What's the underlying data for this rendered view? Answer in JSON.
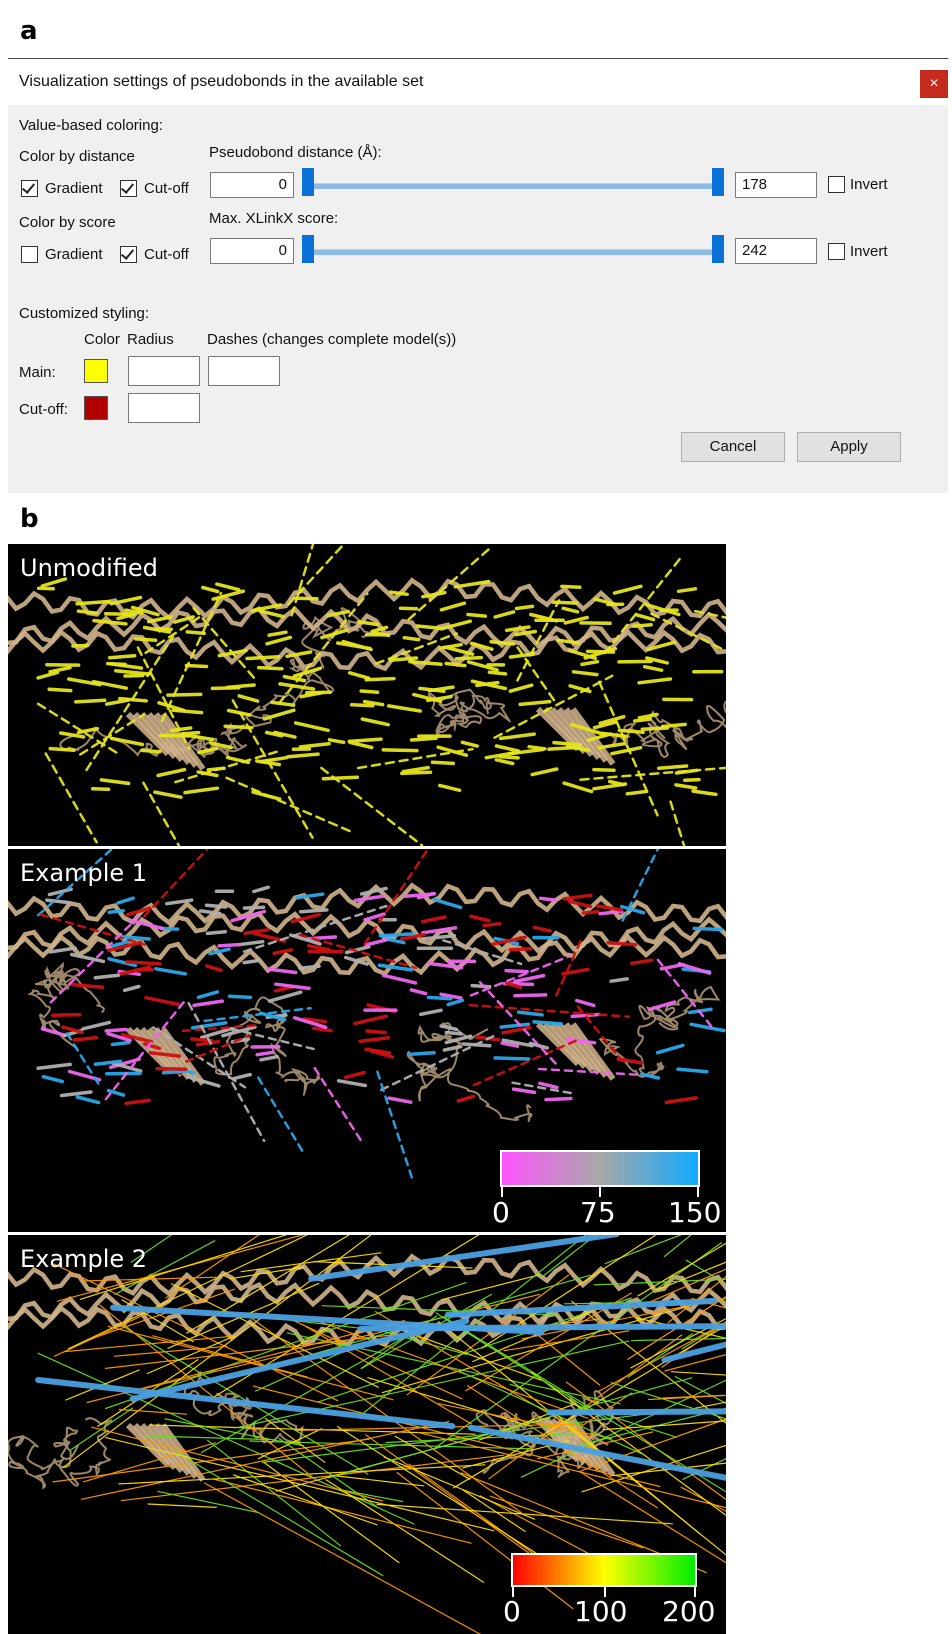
{
  "panel_a_letter": "a",
  "panel_b_letter": "b",
  "dialog": {
    "title": "Visualization settings of pseudobonds in the available set",
    "close_glyph": "×",
    "value_based_coloring_label": "Value-based coloring:",
    "distance": {
      "group_label": "Color by distance",
      "slider_label": "Pseudobond distance (Å):",
      "gradient_label": "Gradient",
      "gradient_checked": true,
      "cutoff_label": "Cut-off",
      "cutoff_checked": true,
      "min_value": "0",
      "max_value": "178",
      "slider_low_fraction": 0,
      "slider_high_fraction": 1,
      "invert_label": "Invert",
      "invert_checked": false
    },
    "score": {
      "group_label": "Color by score",
      "slider_label": "Max. XLinkX score:",
      "gradient_label": "Gradient",
      "gradient_checked": false,
      "cutoff_label": "Cut-off",
      "cutoff_checked": true,
      "min_value": "0",
      "max_value": "242",
      "slider_low_fraction": 0,
      "slider_high_fraction": 1,
      "invert_label": "Invert",
      "invert_checked": false
    },
    "custom": {
      "heading": "Customized styling:",
      "col_color": "Color",
      "col_radius": "Radius",
      "col_dashes": "Dashes (changes complete model(s))",
      "main_label": "Main:",
      "main_color": "#ffff00",
      "main_radius": "",
      "main_dashes": "",
      "cutoff_label": "Cut-off:",
      "cutoff_color": "#b00000",
      "cutoff_radius": ""
    },
    "cancel_label": "Cancel",
    "apply_label": "Apply"
  },
  "views": {
    "unmodified": {
      "label": "Unmodified",
      "bond_color": "#e5e51a"
    },
    "example1": {
      "label": "Example 1",
      "colors": [
        "#ee66ee",
        "#b0b0b0",
        "#29a8e8",
        "#cc1111"
      ],
      "colorbar": {
        "ticks": [
          "0",
          "75",
          "150"
        ],
        "gradient": [
          "#ff55ff",
          "#a8a8a8",
          "#11aaff"
        ]
      }
    },
    "example2": {
      "label": "Example 2",
      "colors": [
        "#ff9900",
        "#ffdd00",
        "#66dd22",
        "#4a9fe0"
      ],
      "colorbar": {
        "ticks": [
          "0",
          "100",
          "200"
        ],
        "gradient": [
          "#ff0000",
          "#ffff00",
          "#00ee00"
        ]
      }
    },
    "protein_color": "#d2b48c"
  }
}
